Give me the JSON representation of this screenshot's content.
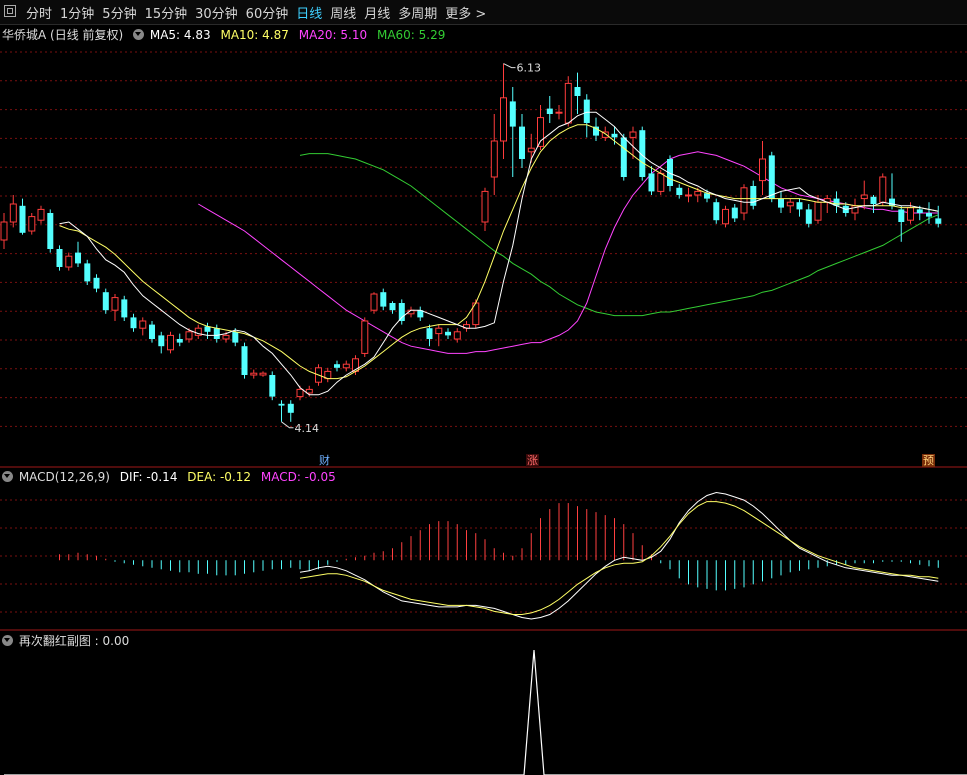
{
  "toolbar": {
    "tabs": [
      "分时",
      "1分钟",
      "5分钟",
      "15分钟",
      "30分钟",
      "60分钟",
      "日线",
      "周线",
      "月线",
      "多周期",
      "更多 >"
    ],
    "active_tab": 6
  },
  "main_header": {
    "title": "华侨城A (日线 前复权)",
    "ma5": "MA5: 4.83",
    "ma10": "MA10: 4.87",
    "ma20": "MA20: 5.10",
    "ma60": "MA60: 5.29"
  },
  "annotations": {
    "high_label": "6.13",
    "low_label": "4.14",
    "markers": [
      "财",
      "涨",
      "预"
    ]
  },
  "macd_header": {
    "title": "MACD(12,26,9)",
    "dif": "DIF: -0.14",
    "dea": "DEA: -0.12",
    "macd": "MACD: -0.05"
  },
  "sub_header": {
    "title": "再次翻红副图 : 0.00"
  },
  "colors": {
    "up": "#ff3c3c",
    "down": "#54ffff",
    "ma5": "#ffffff",
    "ma10": "#ffff66",
    "ma20": "#ff44ff",
    "ma60": "#33cc33",
    "grid": "#7a1010"
  },
  "chart_data": [
    {
      "type": "candlestick",
      "title": "华侨城A (日线 前复权)",
      "ylim": [
        4.05,
        6.25
      ],
      "high": 6.13,
      "low": 4.14,
      "candles": [
        [
          5.15,
          5.25,
          5.1,
          5.3
        ],
        [
          5.25,
          5.35,
          5.22,
          5.4
        ],
        [
          5.34,
          5.19,
          5.18,
          5.38
        ],
        [
          5.2,
          5.28,
          5.18,
          5.3
        ],
        [
          5.26,
          5.32,
          5.24,
          5.34
        ],
        [
          5.3,
          5.1,
          5.08,
          5.32
        ],
        [
          5.1,
          5.0,
          4.98,
          5.12
        ],
        [
          5.0,
          5.06,
          4.98,
          5.08
        ],
        [
          5.08,
          5.02,
          5.0,
          5.14
        ],
        [
          5.02,
          4.92,
          4.9,
          5.04
        ],
        [
          4.94,
          4.88,
          4.86,
          4.96
        ],
        [
          4.86,
          4.76,
          4.74,
          4.88
        ],
        [
          4.76,
          4.83,
          4.7,
          4.85
        ],
        [
          4.82,
          4.72,
          4.7,
          4.84
        ],
        [
          4.72,
          4.66,
          4.64,
          4.74
        ],
        [
          4.66,
          4.7,
          4.62,
          4.72
        ],
        [
          4.68,
          4.6,
          4.58,
          4.7
        ],
        [
          4.62,
          4.56,
          4.52,
          4.64
        ],
        [
          4.54,
          4.62,
          4.52,
          4.64
        ],
        [
          4.6,
          4.58,
          4.56,
          4.63
        ],
        [
          4.6,
          4.64,
          4.58,
          4.66
        ],
        [
          4.62,
          4.66,
          4.6,
          4.68
        ],
        [
          4.67,
          4.64,
          4.6,
          4.69
        ],
        [
          4.66,
          4.6,
          4.58,
          4.68
        ],
        [
          4.6,
          4.62,
          4.58,
          4.64
        ],
        [
          4.64,
          4.58,
          4.56,
          4.66
        ],
        [
          4.56,
          4.4,
          4.38,
          4.58
        ],
        [
          4.4,
          4.41,
          4.38,
          4.43
        ],
        [
          4.4,
          4.41,
          4.39,
          4.42
        ],
        [
          4.4,
          4.28,
          4.26,
          4.42
        ],
        [
          4.24,
          4.23,
          4.14,
          4.26
        ],
        [
          4.24,
          4.19,
          4.14,
          4.26
        ],
        [
          4.28,
          4.32,
          4.26,
          4.34
        ],
        [
          4.3,
          4.32,
          4.28,
          4.34
        ],
        [
          4.36,
          4.44,
          4.34,
          4.46
        ],
        [
          4.38,
          4.42,
          4.36,
          4.44
        ],
        [
          4.46,
          4.44,
          4.42,
          4.48
        ],
        [
          4.44,
          4.46,
          4.42,
          4.48
        ],
        [
          4.42,
          4.49,
          4.4,
          4.51
        ],
        [
          4.52,
          4.7,
          4.5,
          4.72
        ],
        [
          4.76,
          4.85,
          4.74,
          4.86
        ],
        [
          4.86,
          4.78,
          4.76,
          4.88
        ],
        [
          4.8,
          4.76,
          4.74,
          4.81
        ],
        [
          4.8,
          4.7,
          4.68,
          4.82
        ],
        [
          4.74,
          4.76,
          4.72,
          4.78
        ],
        [
          4.76,
          4.72,
          4.7,
          4.78
        ],
        [
          4.66,
          4.6,
          4.56,
          4.68
        ],
        [
          4.63,
          4.66,
          4.56,
          4.68
        ],
        [
          4.64,
          4.62,
          4.6,
          4.66
        ],
        [
          4.6,
          4.64,
          4.58,
          4.66
        ],
        [
          4.66,
          4.68,
          4.64,
          4.7
        ],
        [
          4.68,
          4.8,
          4.66,
          4.82
        ],
        [
          5.25,
          5.42,
          5.2,
          5.44
        ],
        [
          5.5,
          5.7,
          5.4,
          5.85
        ],
        [
          5.7,
          5.94,
          5.6,
          6.13
        ],
        [
          5.92,
          5.78,
          5.5,
          6.0
        ],
        [
          5.78,
          5.6,
          5.55,
          5.85
        ],
        [
          5.64,
          5.66,
          5.58,
          5.74
        ],
        [
          5.67,
          5.83,
          5.65,
          5.9
        ],
        [
          5.88,
          5.85,
          5.8,
          5.95
        ],
        [
          5.86,
          5.86,
          5.82,
          5.9
        ],
        [
          5.8,
          6.02,
          5.78,
          6.06
        ],
        [
          6.0,
          5.95,
          5.85,
          6.08
        ],
        [
          5.93,
          5.8,
          5.72,
          5.96
        ],
        [
          5.78,
          5.73,
          5.7,
          5.83
        ],
        [
          5.72,
          5.75,
          5.7,
          5.78
        ],
        [
          5.74,
          5.72,
          5.68,
          5.78
        ],
        [
          5.72,
          5.5,
          5.48,
          5.74
        ],
        [
          5.72,
          5.75,
          5.6,
          5.78
        ],
        [
          5.76,
          5.5,
          5.48,
          5.78
        ],
        [
          5.52,
          5.42,
          5.4,
          5.56
        ],
        [
          5.42,
          5.52,
          5.4,
          5.54
        ],
        [
          5.6,
          5.45,
          5.42,
          5.62
        ],
        [
          5.44,
          5.4,
          5.38,
          5.46
        ],
        [
          5.4,
          5.4,
          5.36,
          5.44
        ],
        [
          5.4,
          5.42,
          5.36,
          5.44
        ],
        [
          5.41,
          5.38,
          5.36,
          5.43
        ],
        [
          5.36,
          5.26,
          5.24,
          5.38
        ],
        [
          5.24,
          5.32,
          5.22,
          5.34
        ],
        [
          5.33,
          5.27,
          5.25,
          5.35
        ],
        [
          5.3,
          5.44,
          5.26,
          5.46
        ],
        [
          5.45,
          5.34,
          5.32,
          5.48
        ],
        [
          5.48,
          5.6,
          5.4,
          5.7
        ],
        [
          5.62,
          5.38,
          5.36,
          5.64
        ],
        [
          5.38,
          5.33,
          5.3,
          5.42
        ],
        [
          5.34,
          5.36,
          5.3,
          5.38
        ],
        [
          5.36,
          5.32,
          5.28,
          5.38
        ],
        [
          5.32,
          5.24,
          5.22,
          5.35
        ],
        [
          5.26,
          5.36,
          5.24,
          5.4
        ],
        [
          5.36,
          5.38,
          5.3,
          5.4
        ],
        [
          5.38,
          5.34,
          5.3,
          5.42
        ],
        [
          5.34,
          5.3,
          5.28,
          5.36
        ],
        [
          5.3,
          5.34,
          5.26,
          5.38
        ],
        [
          5.38,
          5.4,
          5.32,
          5.48
        ],
        [
          5.39,
          5.35,
          5.3,
          5.4
        ],
        [
          5.36,
          5.5,
          5.34,
          5.52
        ],
        [
          5.38,
          5.34,
          5.32,
          5.52
        ],
        [
          5.32,
          5.25,
          5.14,
          5.34
        ],
        [
          5.26,
          5.33,
          5.24,
          5.36
        ],
        [
          5.32,
          5.3,
          5.26,
          5.34
        ],
        [
          5.3,
          5.28,
          5.24,
          5.36
        ],
        [
          5.27,
          5.24,
          5.22,
          5.34
        ]
      ],
      "ma5": [
        5.24,
        5.25,
        5.21,
        5.17,
        5.1,
        5.04,
        5.01,
        4.97,
        4.9,
        4.84,
        4.8,
        4.76,
        4.72,
        4.68,
        4.65,
        4.63,
        4.62,
        4.62,
        4.63,
        4.65,
        4.64,
        4.61,
        4.56,
        4.52,
        4.46,
        4.4,
        4.33,
        4.29,
        4.29,
        4.31,
        4.36,
        4.4,
        4.43,
        4.46,
        4.5,
        4.58,
        4.66,
        4.72,
        4.76,
        4.76,
        4.74,
        4.72,
        4.7,
        4.68,
        4.66,
        4.66,
        4.67,
        4.69,
        4.92,
        5.12,
        5.38,
        5.6,
        5.7,
        5.74,
        5.78,
        5.8,
        5.84,
        5.86,
        5.86,
        5.82,
        5.78,
        5.72,
        5.67,
        5.62,
        5.58,
        5.55,
        5.52,
        5.5,
        5.47,
        5.45,
        5.42,
        5.4,
        5.38,
        5.37,
        5.36,
        5.36,
        5.38,
        5.4,
        5.42,
        5.43,
        5.44,
        5.4,
        5.38,
        5.36,
        5.34,
        5.32,
        5.33,
        5.34,
        5.34,
        5.36,
        5.35,
        5.34,
        5.34,
        5.33,
        5.32,
        5.31
      ],
      "ma10": [
        5.23,
        5.21,
        5.2,
        5.17,
        5.14,
        5.11,
        5.07,
        5.02,
        4.97,
        4.92,
        4.88,
        4.84,
        4.8,
        4.76,
        4.72,
        4.69,
        4.67,
        4.66,
        4.65,
        4.64,
        4.63,
        4.61,
        4.59,
        4.56,
        4.53,
        4.49,
        4.45,
        4.42,
        4.4,
        4.38,
        4.38,
        4.39,
        4.42,
        4.45,
        4.49,
        4.53,
        4.57,
        4.61,
        4.64,
        4.66,
        4.67,
        4.68,
        4.68,
        4.68,
        4.72,
        4.8,
        4.92,
        5.06,
        5.2,
        5.32,
        5.44,
        5.55,
        5.64,
        5.7,
        5.74,
        5.77,
        5.79,
        5.79,
        5.77,
        5.74,
        5.7,
        5.66,
        5.62,
        5.58,
        5.55,
        5.52,
        5.49,
        5.47,
        5.45,
        5.43,
        5.41,
        5.4,
        5.39,
        5.38,
        5.38,
        5.38,
        5.38,
        5.38,
        5.38,
        5.38,
        5.38,
        5.37,
        5.36,
        5.36,
        5.35,
        5.35,
        5.34,
        5.34,
        5.34,
        5.34,
        5.34,
        5.33,
        5.33,
        5.33,
        5.32,
        5.31
      ],
      "ma20": [
        5.35,
        5.32,
        5.29,
        5.26,
        5.23,
        5.2,
        5.16,
        5.12,
        5.08,
        5.04,
        5.0,
        4.96,
        4.92,
        4.88,
        4.84,
        4.8,
        4.76,
        4.73,
        4.7,
        4.67,
        4.64,
        4.61,
        4.58,
        4.56,
        4.55,
        4.54,
        4.53,
        4.52,
        4.52,
        4.52,
        4.53,
        4.53,
        4.54,
        4.55,
        4.56,
        4.57,
        4.58,
        4.58,
        4.6,
        4.62,
        4.65,
        4.7,
        4.8,
        4.95,
        5.1,
        5.22,
        5.32,
        5.4,
        5.46,
        5.52,
        5.56,
        5.6,
        5.62,
        5.63,
        5.64,
        5.63,
        5.62,
        5.6,
        5.58,
        5.56,
        5.53,
        5.5,
        5.47,
        5.44,
        5.42,
        5.4,
        5.39,
        5.38,
        5.37,
        5.36,
        5.35,
        5.34,
        5.33,
        5.32,
        5.32,
        5.31,
        5.31,
        5.3,
        5.3,
        5.3,
        5.3
      ],
      "ma60": [
        5.62,
        5.63,
        5.63,
        5.63,
        5.62,
        5.61,
        5.6,
        5.58,
        5.56,
        5.54,
        5.51,
        5.48,
        5.45,
        5.41,
        5.37,
        5.33,
        5.29,
        5.25,
        5.21,
        5.17,
        5.13,
        5.09,
        5.06,
        5.02,
        4.99,
        4.96,
        4.92,
        4.89,
        4.85,
        4.82,
        4.79,
        4.77,
        4.75,
        4.74,
        4.73,
        4.73,
        4.73,
        4.73,
        4.74,
        4.75,
        4.75,
        4.76,
        4.77,
        4.78,
        4.79,
        4.8,
        4.81,
        4.82,
        4.83,
        4.84,
        4.86,
        4.87,
        4.89,
        4.91,
        4.93,
        4.95,
        4.98,
        5.0,
        5.02,
        5.04,
        5.06,
        5.08,
        5.1,
        5.12,
        5.15,
        5.18,
        5.21,
        5.24,
        5.27,
        5.29
      ]
    },
    {
      "type": "bar",
      "title": "MACD(12,26,9)",
      "ylim": [
        -0.45,
        0.5
      ],
      "histogram": [
        0.04,
        0.04,
        0.05,
        0.04,
        0.03,
        0.01,
        -0.01,
        -0.02,
        -0.03,
        -0.04,
        -0.05,
        -0.06,
        -0.07,
        -0.08,
        -0.08,
        -0.09,
        -0.09,
        -0.1,
        -0.1,
        -0.1,
        -0.09,
        -0.08,
        -0.07,
        -0.06,
        -0.06,
        -0.05,
        -0.06,
        -0.07,
        -0.06,
        -0.03,
        -0.01,
        0.01,
        0.02,
        0.03,
        0.05,
        0.06,
        0.08,
        0.12,
        0.16,
        0.2,
        0.24,
        0.26,
        0.26,
        0.24,
        0.2,
        0.18,
        0.14,
        0.08,
        0.05,
        0.03,
        0.08,
        0.18,
        0.28,
        0.34,
        0.38,
        0.38,
        0.36,
        0.34,
        0.32,
        0.3,
        0.28,
        0.24,
        0.18,
        0.1,
        0.04,
        -0.02,
        -0.06,
        -0.12,
        -0.16,
        -0.18,
        -0.19,
        -0.2,
        -0.2,
        -0.19,
        -0.18,
        -0.16,
        -0.14,
        -0.12,
        -0.1,
        -0.08,
        -0.07,
        -0.06,
        -0.05,
        -0.04,
        -0.03,
        -0.03,
        -0.02,
        -0.02,
        -0.02,
        -0.01,
        -0.01,
        -0.01,
        -0.02,
        -0.03,
        -0.04,
        -0.05
      ],
      "dif": [
        -0.08,
        -0.07,
        -0.05,
        -0.04,
        -0.05,
        -0.07,
        -0.1,
        -0.13,
        -0.17,
        -0.21,
        -0.24,
        -0.27,
        -0.28,
        -0.29,
        -0.3,
        -0.31,
        -0.31,
        -0.31,
        -0.3,
        -0.3,
        -0.31,
        -0.32,
        -0.34,
        -0.36,
        -0.38,
        -0.39,
        -0.38,
        -0.36,
        -0.32,
        -0.27,
        -0.21,
        -0.15,
        -0.09,
        -0.04,
        0.0,
        0.02,
        0.01,
        0.0,
        0.02,
        0.06,
        0.14,
        0.25,
        0.33,
        0.39,
        0.43,
        0.45,
        0.44,
        0.42,
        0.4,
        0.36,
        0.31,
        0.25,
        0.19,
        0.13,
        0.08,
        0.05,
        0.02,
        -0.01,
        -0.03,
        -0.05,
        -0.06,
        -0.07,
        -0.08,
        -0.09,
        -0.1,
        -0.1,
        -0.11,
        -0.12,
        -0.13,
        -0.14
      ],
      "dea": [
        -0.12,
        -0.11,
        -0.1,
        -0.09,
        -0.09,
        -0.1,
        -0.12,
        -0.14,
        -0.17,
        -0.2,
        -0.22,
        -0.24,
        -0.26,
        -0.27,
        -0.28,
        -0.29,
        -0.3,
        -0.3,
        -0.3,
        -0.31,
        -0.32,
        -0.34,
        -0.35,
        -0.36,
        -0.36,
        -0.35,
        -0.33,
        -0.3,
        -0.26,
        -0.21,
        -0.16,
        -0.12,
        -0.08,
        -0.05,
        -0.03,
        -0.02,
        -0.02,
        -0.01,
        0.03,
        0.09,
        0.16,
        0.24,
        0.31,
        0.36,
        0.39,
        0.39,
        0.38,
        0.36,
        0.33,
        0.29,
        0.25,
        0.21,
        0.17,
        0.13,
        0.09,
        0.06,
        0.03,
        0.01,
        -0.01,
        -0.03,
        -0.05,
        -0.06,
        -0.07,
        -0.08,
        -0.09,
        -0.1,
        -0.1,
        -0.11,
        -0.11,
        -0.12
      ]
    },
    {
      "type": "line",
      "title": "再次翻红副图",
      "ylim": [
        0,
        1
      ],
      "values": [
        0,
        0,
        0,
        0,
        0,
        0,
        0,
        0,
        0,
        0,
        0,
        0,
        0,
        0,
        0,
        0,
        0,
        0,
        0,
        0,
        0,
        0,
        0,
        0,
        0,
        0,
        0,
        0,
        0,
        0,
        0,
        0,
        0,
        0,
        0,
        0,
        0,
        0,
        0,
        0,
        0,
        0,
        0,
        0,
        0,
        0,
        0,
        0,
        0,
        0,
        0,
        0,
        0,
        1,
        0,
        0,
        0,
        0,
        0,
        0,
        0,
        0,
        0,
        0,
        0,
        0,
        0,
        0,
        0,
        0,
        0,
        0,
        0,
        0,
        0,
        0,
        0,
        0,
        0,
        0,
        0,
        0,
        0,
        0,
        0,
        0,
        0,
        0,
        0,
        0,
        0,
        0,
        0,
        0,
        0,
        0,
        0,
        0,
        0,
        0,
        0,
        0,
        0,
        0
      ]
    }
  ]
}
